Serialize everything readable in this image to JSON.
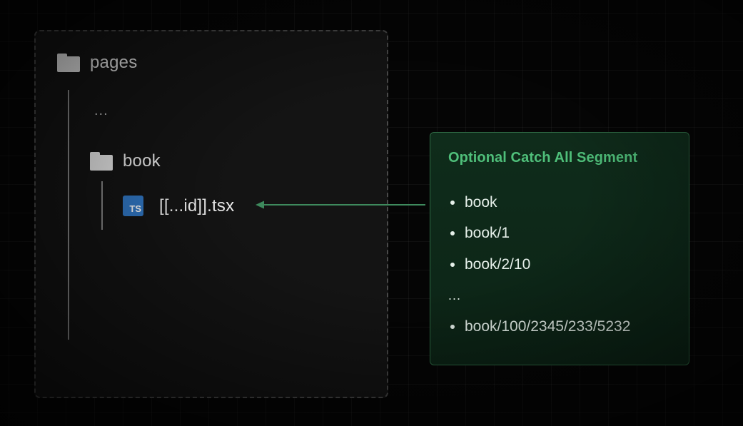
{
  "tree": {
    "root_label": "pages",
    "root_icon": "folder-icon",
    "ellipsis": "...",
    "folder_label": "book",
    "folder_icon": "folder-icon",
    "file_label": "[[...id]].tsx",
    "file_icon": "typescript-file-icon",
    "file_icon_text": "TS"
  },
  "card": {
    "title": "Optional Catch All Segment",
    "routes": [
      "book",
      "book/1",
      "book/2/10"
    ],
    "ellipsis": "...",
    "last_route": "book/100/2345/233/5232"
  },
  "colors": {
    "accent_green": "#4fbf7a",
    "card_border": "#2f6b45",
    "ts_blue": "#3178c6",
    "arrow": "#3e8a5d"
  }
}
